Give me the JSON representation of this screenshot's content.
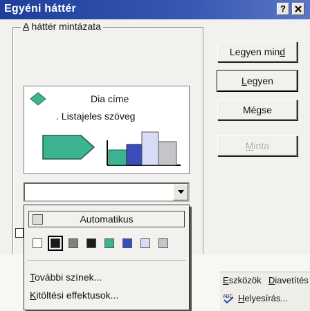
{
  "window": {
    "title": "Egyéni háttér",
    "help_glyph": "?",
    "close_glyph": "✕"
  },
  "group": {
    "label_first": "A",
    "label_rest": " háttér mintázata"
  },
  "buttons": {
    "apply_all": {
      "pre": "Legyen min",
      "ul": "d",
      "post": ""
    },
    "apply": {
      "pre": "",
      "ul": "L",
      "post": "egyen"
    },
    "cancel": {
      "pre": "Mégse",
      "ul": "",
      "post": ""
    },
    "preview": {
      "pre": "",
      "ul": "M",
      "post": "inta"
    }
  },
  "preview_slide": {
    "title": "Dia címe",
    "bullet": ". Listajeles szöveg"
  },
  "combo": {
    "value": "",
    "arrow_icon": "chevron-down-icon"
  },
  "dropdown": {
    "automatic_label": "Automatikus",
    "swatches": [
      "#ffffff",
      "#1a1a1a",
      "#808080",
      "#1c1c1c",
      "#3cb391",
      "#3a4dbf",
      "#d8dbf5",
      "#c4c5c8"
    ],
    "selected_index": 1,
    "more_colors": {
      "ul": "T",
      "rest": "ovábbi színek..."
    },
    "fill_effects": {
      "ul": "K",
      "rest": "itöltési effektusok..."
    }
  },
  "background_app": {
    "toolbar_tools": {
      "ul": "E",
      "rest": "szközök"
    },
    "toolbar_slideshow": {
      "ul": "D",
      "rest": "iavetítés"
    },
    "spelling": {
      "ul": "H",
      "rest": "elyesírás..."
    }
  },
  "colors": {
    "titlebar": "#1e3e9b",
    "shape_teal": "#3cb391",
    "shape_blue": "#3a4dbf",
    "shape_lavender": "#d8dbf5",
    "shape_gray": "#c4c5c8"
  }
}
